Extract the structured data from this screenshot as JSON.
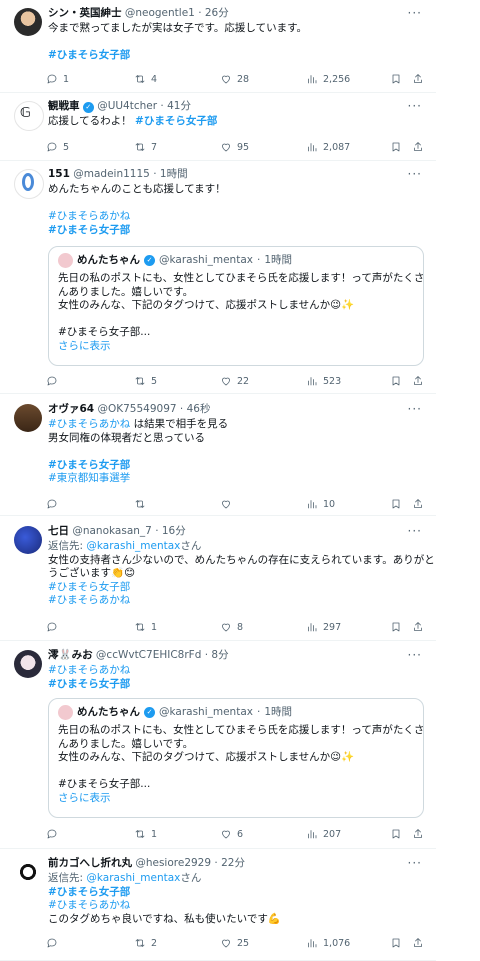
{
  "tweets": [
    {
      "name": "シン・英国紳士",
      "handle": "@neogentle1",
      "time": "26分",
      "lines": [
        {
          "segments": [
            {
              "text": "今まで黙ってましたが実は女子です。応援しています。",
              "style": "text"
            }
          ]
        },
        {
          "segments": [
            {
              "text": "",
              "style": "text"
            }
          ]
        },
        {
          "segments": [
            {
              "text": "#ひまそら女子部",
              "style": "tag-b"
            }
          ]
        }
      ],
      "actions": {
        "reply": "1",
        "retweet": "4",
        "like": "28",
        "views": "2,256"
      }
    },
    {
      "name": "観戦車",
      "handle": "@UU4tcher",
      "time": "41分",
      "verified": true,
      "lines": [
        {
          "segments": [
            {
              "text": "応援してるわよ！ ",
              "style": "text"
            },
            {
              "text": "#ひまそら女子部",
              "style": "tag-b"
            }
          ]
        }
      ],
      "actions": {
        "reply": "5",
        "retweet": "7",
        "like": "95",
        "views": "2,087"
      }
    },
    {
      "name": "151",
      "handle": "@madein1115",
      "time": "1時間",
      "lines": [
        {
          "segments": [
            {
              "text": "めんたちゃんのことも応援してます！",
              "style": "text"
            }
          ]
        },
        {
          "segments": [
            {
              "text": "",
              "style": "text"
            }
          ]
        },
        {
          "segments": [
            {
              "text": "#ひまそらあかね",
              "style": "tag"
            }
          ]
        },
        {
          "segments": [
            {
              "text": "#ひまそら女子部",
              "style": "tag-b"
            }
          ]
        }
      ],
      "quote": {
        "name": "めんたちゃん",
        "handle": "@karashi_mentax",
        "time": "1時間",
        "lines": [
          "先日の私のポストにも、女性としてひまそら氏を応援します！って声がたくさ",
          "んありました。嬉しいです。",
          "女性のみんな、下記のタグつけて、応援ポストしませんか😉✨",
          "",
          "#ひまそら女子部..."
        ],
        "show_more": "さらに表示"
      },
      "actions": {
        "reply": "",
        "retweet": "5",
        "like": "22",
        "views": "523"
      }
    },
    {
      "name": "オヴァ64",
      "handle": "@OK75549097",
      "time": "46秒",
      "lines": [
        {
          "segments": [
            {
              "text": "#ひまそらあかね",
              "style": "tag"
            },
            {
              "text": " は結果で相手を見る",
              "style": "text"
            }
          ]
        },
        {
          "segments": [
            {
              "text": "男女同権の体現者だと思っている",
              "style": "text"
            }
          ]
        },
        {
          "segments": [
            {
              "text": "",
              "style": "text"
            }
          ]
        },
        {
          "segments": [
            {
              "text": "#ひまそら女子部",
              "style": "tag-b"
            }
          ]
        },
        {
          "segments": [
            {
              "text": "#東京都知事選挙",
              "style": "tag"
            }
          ]
        }
      ],
      "actions": {
        "reply": "",
        "retweet": "",
        "like": "",
        "views": "10"
      }
    },
    {
      "name": "七日",
      "handle": "@nanokasan_7",
      "time": "16分",
      "reply_to": {
        "prefix": "返信先: ",
        "target": "@karashi_mentax",
        "suffix": "さん"
      },
      "lines": [
        {
          "segments": [
            {
              "text": "女性の支持者さん少ないので、めんたちゃんの存在に支えられています。ありがと",
              "style": "text"
            }
          ]
        },
        {
          "segments": [
            {
              "text": "うございます👏😊",
              "style": "text"
            }
          ]
        },
        {
          "segments": [
            {
              "text": "#ひまそら女子部",
              "style": "tag"
            }
          ]
        },
        {
          "segments": [
            {
              "text": "#ひまそらあかね",
              "style": "tag"
            }
          ]
        }
      ],
      "actions": {
        "reply": "",
        "retweet": "1",
        "like": "8",
        "views": "297"
      }
    },
    {
      "name": "澪🐰みお",
      "handle": "@ccWvtC7EHIC8rFd",
      "time": "8分",
      "lines": [
        {
          "segments": [
            {
              "text": "#ひまそらあかね",
              "style": "tag"
            }
          ]
        },
        {
          "segments": [
            {
              "text": "#ひまそら女子部",
              "style": "tag-b"
            }
          ]
        }
      ],
      "quote": {
        "name": "めんたちゃん",
        "handle": "@karashi_mentax",
        "time": "1時間",
        "lines": [
          "先日の私のポストにも、女性としてひまそら氏を応援します！って声がたくさ",
          "んありました。嬉しいです。",
          "女性のみんな、下記のタグつけて、応援ポストしませんか😉✨",
          "",
          "#ひまそら女子部..."
        ],
        "show_more": "さらに表示"
      },
      "actions": {
        "reply": "",
        "retweet": "1",
        "like": "6",
        "views": "207"
      }
    },
    {
      "name": "前カゴへし折れ丸",
      "handle": "@hesiore2929",
      "time": "22分",
      "reply_to": {
        "prefix": "返信先: ",
        "target": "@karashi_mentax",
        "suffix": "さん"
      },
      "lines": [
        {
          "segments": [
            {
              "text": "#ひまそら女子部",
              "style": "tag-b"
            }
          ]
        },
        {
          "segments": [
            {
              "text": "#ひまそらあかね",
              "style": "tag"
            }
          ]
        },
        {
          "segments": [
            {
              "text": "このタグめちゃ良いですね、私も使いたいです💪",
              "style": "text"
            }
          ]
        }
      ],
      "actions": {
        "reply": "",
        "retweet": "2",
        "like": "25",
        "views": "1,076"
      }
    }
  ],
  "colors": {
    "accent": "#1d9bf0",
    "text": "#0f1419",
    "muted": "#536471",
    "border": "#eff3f4"
  }
}
